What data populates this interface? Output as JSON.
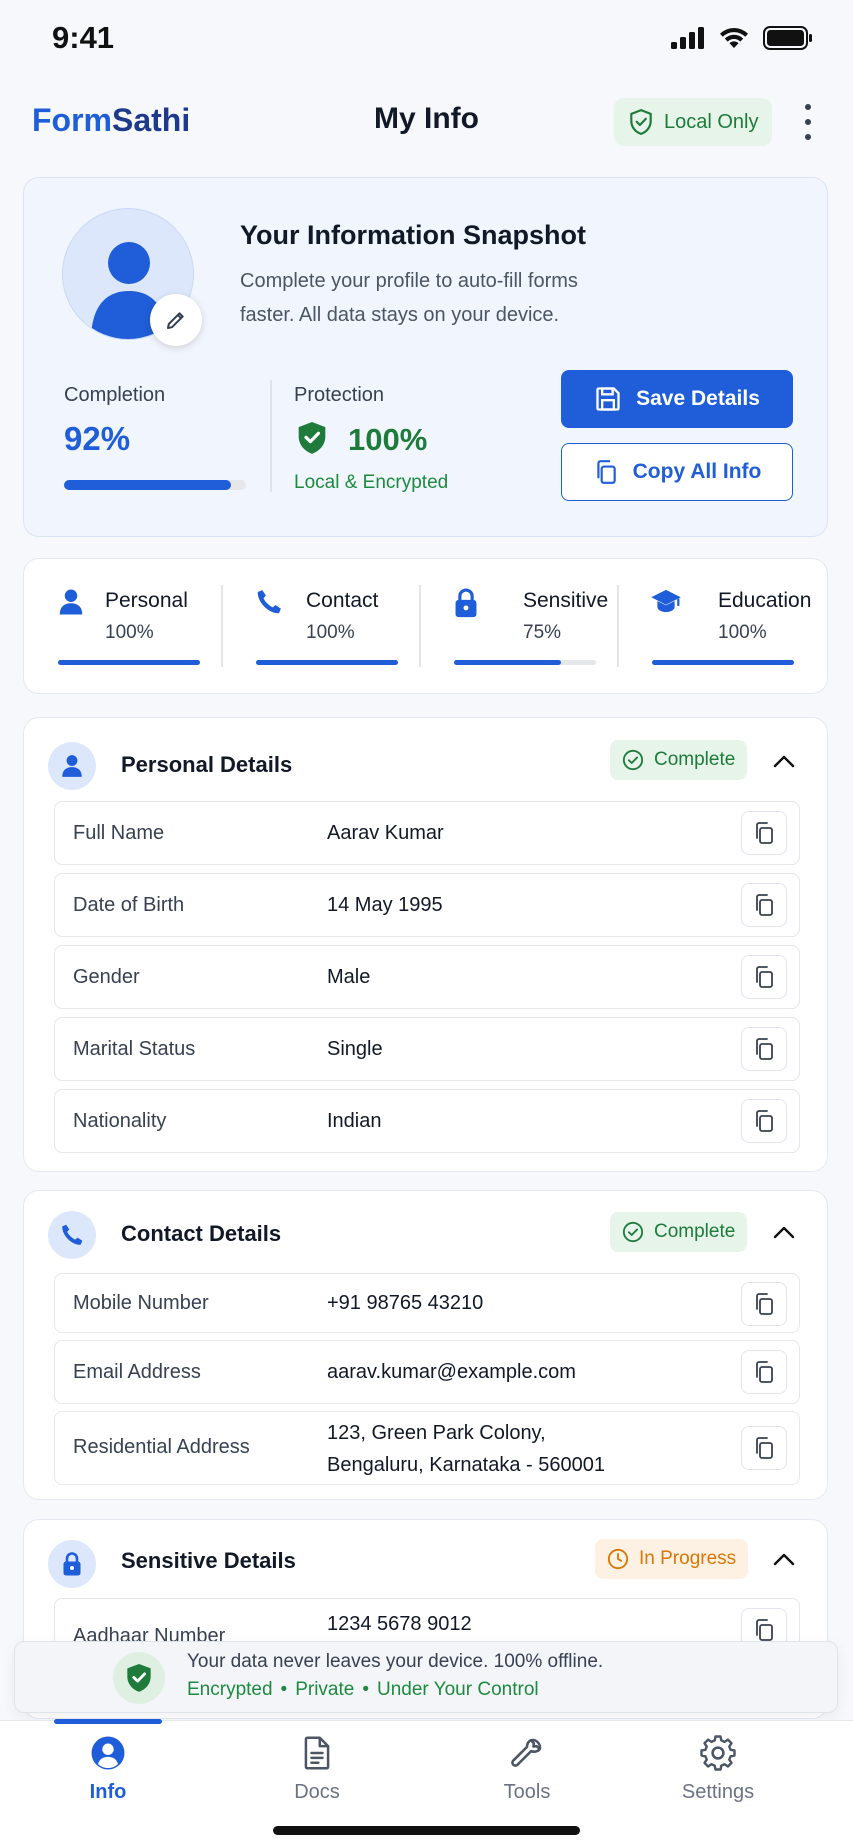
{
  "status_bar": {
    "time": "9:41"
  },
  "header": {
    "brand_part1": "Form",
    "brand_part2": "Sathi",
    "title": "My Info",
    "badge": "Local Only"
  },
  "snapshot": {
    "title": "Your Information Snapshot",
    "description": "Complete your profile to auto-fill forms faster. All data stays on your device.",
    "completion_label": "Completion",
    "completion_value": "92%",
    "completion_fraction": 0.92,
    "protection_label": "Protection",
    "protection_value": "100%",
    "protection_sub": "Local & Encrypted",
    "save_button": "Save Details",
    "copy_button": "Copy All Info"
  },
  "categories": [
    {
      "name": "Personal",
      "pct": "100%",
      "fraction": 1.0,
      "icon": "person-icon"
    },
    {
      "name": "Contact",
      "pct": "100%",
      "fraction": 1.0,
      "icon": "phone-icon"
    },
    {
      "name": "Sensitive",
      "pct": "75%",
      "fraction": 0.75,
      "icon": "lock-icon"
    },
    {
      "name": "Education",
      "pct": "100%",
      "fraction": 1.0,
      "icon": "graduation-cap-icon"
    }
  ],
  "personal": {
    "title": "Personal Details",
    "status": "Complete",
    "rows": [
      {
        "label": "Full Name",
        "value": "Aarav Kumar"
      },
      {
        "label": "Date of Birth",
        "value": "14 May 1995"
      },
      {
        "label": "Gender",
        "value": "Male"
      },
      {
        "label": "Marital Status",
        "value": "Single"
      },
      {
        "label": "Nationality",
        "value": "Indian"
      }
    ]
  },
  "contact": {
    "title": "Contact Details",
    "status": "Complete",
    "rows": [
      {
        "label": "Mobile Number",
        "value": "+91 98765 43210"
      },
      {
        "label": "Email Address",
        "value": "aarav.kumar@example.com"
      },
      {
        "label": "Residential Address",
        "value_line1": "123, Green Park Colony,",
        "value_line2": "Bengaluru, Karnataka - 560001"
      }
    ]
  },
  "sensitive": {
    "title": "Sensitive Details",
    "status": "In Progress",
    "rows": [
      {
        "label": "Aadhaar Number",
        "value": "1234 5678 9012"
      }
    ]
  },
  "privacy_banner": {
    "line1": "Your data never leaves your device. 100% offline.",
    "tag1": "Encrypted",
    "tag2": "Private",
    "tag3": "Under Your Control"
  },
  "bottom_nav": [
    {
      "label": "Info",
      "icon": "user-circle-icon",
      "active": true
    },
    {
      "label": "Docs",
      "icon": "document-icon",
      "active": false
    },
    {
      "label": "Tools",
      "icon": "wrench-icon",
      "active": false
    },
    {
      "label": "Settings",
      "icon": "gear-icon",
      "active": false
    }
  ],
  "colors": {
    "primary": "#1f5ed8",
    "success": "#1e7b3c",
    "warning": "#d97706",
    "background": "#f7f8fc"
  }
}
